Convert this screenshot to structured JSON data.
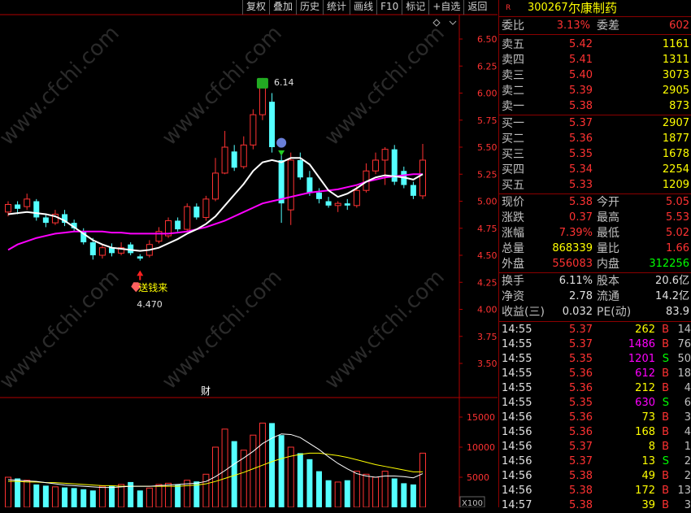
{
  "toolbar": {
    "buttons": [
      "复权",
      "叠加",
      "历史",
      "统计",
      "画线",
      "F10",
      "标记",
      "+自选",
      "返回"
    ]
  },
  "watermark": "www.cfchi.com",
  "main_chart": {
    "y_ticks": [
      "6.50",
      "6.25",
      "6.00",
      "5.75",
      "5.50",
      "5.25",
      "5.00",
      "4.75",
      "4.50",
      "4.25",
      "4.00",
      "3.75",
      "3.50"
    ],
    "high_label": "6.14",
    "low_label": "4.470",
    "buy_signal_text": "送钱来",
    "finance_marker": "财",
    "colors": {
      "up": "#ff3232",
      "down": "#54ffff",
      "ma_white": "#ffffff",
      "ma_magenta": "#ff00ff",
      "axis": "#b00000"
    }
  },
  "volume_chart": {
    "y_ticks": [
      "15000",
      "10000",
      "5000"
    ],
    "unit": "X100"
  },
  "chart_data": [
    {
      "type": "candlestick",
      "ylim": [
        3.3,
        6.6
      ],
      "candles": [
        {
          "o": 4.9,
          "c": 4.97,
          "h": 5.0,
          "l": 4.86
        },
        {
          "o": 4.97,
          "c": 4.93,
          "h": 5.0,
          "l": 4.88
        },
        {
          "o": 4.95,
          "c": 5.02,
          "h": 5.07,
          "l": 4.92
        },
        {
          "o": 5.0,
          "c": 4.85,
          "h": 5.02,
          "l": 4.82
        },
        {
          "o": 4.85,
          "c": 4.8,
          "h": 4.88,
          "l": 4.76
        },
        {
          "o": 4.8,
          "c": 4.88,
          "h": 4.92,
          "l": 4.78
        },
        {
          "o": 4.88,
          "c": 4.8,
          "h": 4.92,
          "l": 4.77
        },
        {
          "o": 4.8,
          "c": 4.75,
          "h": 4.83,
          "l": 4.72
        },
        {
          "o": 4.72,
          "c": 4.62,
          "h": 4.75,
          "l": 4.6
        },
        {
          "o": 4.62,
          "c": 4.5,
          "h": 4.66,
          "l": 4.46
        },
        {
          "o": 4.5,
          "c": 4.57,
          "h": 4.6,
          "l": 4.47
        },
        {
          "o": 4.57,
          "c": 4.52,
          "h": 4.61,
          "l": 4.49
        },
        {
          "o": 4.52,
          "c": 4.57,
          "h": 4.62,
          "l": 4.5
        },
        {
          "o": 4.6,
          "c": 4.52,
          "h": 4.62,
          "l": 4.5
        },
        {
          "o": 4.49,
          "c": 4.47,
          "h": 4.51,
          "l": 4.45
        },
        {
          "o": 4.5,
          "c": 4.6,
          "h": 4.64,
          "l": 4.48
        },
        {
          "o": 4.63,
          "c": 4.72,
          "h": 4.76,
          "l": 4.61
        },
        {
          "o": 4.68,
          "c": 4.82,
          "h": 4.85,
          "l": 4.66
        },
        {
          "o": 4.82,
          "c": 4.74,
          "h": 4.85,
          "l": 4.72
        },
        {
          "o": 4.74,
          "c": 4.95,
          "h": 4.98,
          "l": 4.72
        },
        {
          "o": 4.95,
          "c": 4.85,
          "h": 4.98,
          "l": 4.83
        },
        {
          "o": 4.85,
          "c": 5.02,
          "h": 5.05,
          "l": 4.82
        },
        {
          "o": 5.02,
          "c": 5.26,
          "h": 5.4,
          "l": 5.0
        },
        {
          "o": 5.26,
          "c": 5.5,
          "h": 5.65,
          "l": 5.25
        },
        {
          "o": 5.46,
          "c": 5.31,
          "h": 5.52,
          "l": 5.28
        },
        {
          "o": 5.32,
          "c": 5.52,
          "h": 5.6,
          "l": 5.3
        },
        {
          "o": 5.52,
          "c": 5.8,
          "h": 5.85,
          "l": 5.48
        },
        {
          "o": 5.8,
          "c": 6.08,
          "h": 6.14,
          "l": 5.75
        },
        {
          "o": 5.92,
          "c": 5.5,
          "h": 6.0,
          "l": 5.45
        },
        {
          "o": 5.38,
          "c": 4.98,
          "h": 5.45,
          "l": 4.8
        },
        {
          "o": 4.92,
          "c": 5.38,
          "h": 5.45,
          "l": 4.78
        },
        {
          "o": 5.38,
          "c": 5.22,
          "h": 5.45,
          "l": 5.2
        },
        {
          "o": 5.22,
          "c": 5.08,
          "h": 5.28,
          "l": 5.05
        },
        {
          "o": 5.08,
          "c": 5.02,
          "h": 5.12,
          "l": 4.98
        },
        {
          "o": 5.0,
          "c": 4.96,
          "h": 5.04,
          "l": 4.94
        },
        {
          "o": 4.96,
          "c": 4.98,
          "h": 5.0,
          "l": 4.9
        },
        {
          "o": 4.98,
          "c": 4.96,
          "h": 5.02,
          "l": 4.92
        },
        {
          "o": 4.96,
          "c": 5.1,
          "h": 5.14,
          "l": 4.94
        },
        {
          "o": 5.1,
          "c": 5.28,
          "h": 5.35,
          "l": 5.08
        },
        {
          "o": 5.28,
          "c": 5.38,
          "h": 5.45,
          "l": 5.25
        },
        {
          "o": 5.38,
          "c": 5.48,
          "h": 5.5,
          "l": 5.15
        },
        {
          "o": 5.48,
          "c": 5.18,
          "h": 5.52,
          "l": 5.15
        },
        {
          "o": 5.28,
          "c": 5.15,
          "h": 5.32,
          "l": 5.12
        },
        {
          "o": 5.15,
          "c": 5.05,
          "h": 5.18,
          "l": 5.02
        },
        {
          "o": 5.05,
          "c": 5.38,
          "h": 5.53,
          "l": 5.02
        }
      ],
      "ma_white": [
        4.88,
        4.89,
        4.9,
        4.89,
        4.88,
        4.86,
        4.82,
        4.76,
        4.7,
        4.64,
        4.6,
        4.57,
        4.56,
        4.55,
        4.54,
        4.55,
        4.57,
        4.61,
        4.65,
        4.7,
        4.74,
        4.79,
        4.86,
        4.96,
        5.06,
        5.16,
        5.28,
        5.36,
        5.38,
        5.36,
        5.4,
        5.4,
        5.34,
        5.22,
        5.1,
        5.04,
        5.07,
        5.12,
        5.18,
        5.22,
        5.24,
        5.23,
        5.22,
        5.2,
        5.25
      ],
      "ma_magenta": [
        4.55,
        4.6,
        4.63,
        4.66,
        4.68,
        4.7,
        4.71,
        4.72,
        4.72,
        4.72,
        4.72,
        4.71,
        4.71,
        4.7,
        4.7,
        4.7,
        4.7,
        4.7,
        4.71,
        4.72,
        4.74,
        4.76,
        4.79,
        4.82,
        4.86,
        4.9,
        4.94,
        4.98,
        5.0,
        5.02,
        5.04,
        5.06,
        5.08,
        5.09,
        5.1,
        5.11,
        5.13,
        5.15,
        5.18,
        5.2,
        5.22,
        5.23,
        5.24,
        5.25,
        5.25
      ]
    },
    {
      "type": "bar",
      "ylim": [
        0,
        17000
      ],
      "values": [
        5000,
        4800,
        4500,
        3800,
        3600,
        3400,
        3300,
        3200,
        3000,
        2800,
        3500,
        3600,
        3800,
        4200,
        2800,
        3200,
        3800,
        4000,
        3800,
        4500,
        4300,
        5500,
        10000,
        13000,
        11000,
        9500,
        12000,
        14000,
        14000,
        12000,
        10000,
        9000,
        8000,
        6000,
        4500,
        4200,
        4500,
        6000,
        5500,
        5000,
        6000,
        4800,
        4000,
        3800,
        9000
      ],
      "ma_white": [
        4600,
        4500,
        4400,
        4300,
        4100,
        3900,
        3700,
        3600,
        3500,
        3400,
        3300,
        3300,
        3400,
        3500,
        3500,
        3500,
        3600,
        3700,
        3800,
        3900,
        4000,
        4300,
        5100,
        6100,
        7200,
        8200,
        9300,
        10600,
        11500,
        12200,
        12100,
        11600,
        10600,
        9600,
        8400,
        7300,
        6400,
        5600,
        5200,
        5000,
        5200,
        5200,
        5100,
        4900,
        5600
      ],
      "ma_yellow": [
        4300,
        4300,
        4200,
        4200,
        4100,
        4100,
        4000,
        3900,
        3800,
        3700,
        3600,
        3600,
        3500,
        3500,
        3500,
        3500,
        3500,
        3500,
        3500,
        3600,
        3700,
        3900,
        4300,
        4800,
        5300,
        5800,
        6400,
        7000,
        7600,
        8100,
        8500,
        8800,
        9000,
        9000,
        8800,
        8600,
        8300,
        7900,
        7500,
        7100,
        6800,
        6500,
        6200,
        5900,
        5900
      ]
    }
  ],
  "quote": {
    "rank_mark": "R",
    "code": "300267",
    "name": "尔康制药",
    "weibi_label": "委比",
    "weibi_value": "3.13%",
    "weicha_label": "委差",
    "weicha_value": "602",
    "asks": [
      {
        "label": "卖五",
        "price": "5.42",
        "vol": "1161"
      },
      {
        "label": "卖四",
        "price": "5.41",
        "vol": "1311"
      },
      {
        "label": "卖三",
        "price": "5.40",
        "vol": "3073"
      },
      {
        "label": "卖二",
        "price": "5.39",
        "vol": "2905"
      },
      {
        "label": "卖一",
        "price": "5.38",
        "vol": "873"
      }
    ],
    "bids": [
      {
        "label": "买一",
        "price": "5.37",
        "vol": "2907"
      },
      {
        "label": "买二",
        "price": "5.36",
        "vol": "1877"
      },
      {
        "label": "买三",
        "price": "5.35",
        "vol": "1678"
      },
      {
        "label": "买四",
        "price": "5.34",
        "vol": "2254"
      },
      {
        "label": "买五",
        "price": "5.33",
        "vol": "1209"
      }
    ],
    "stats": [
      {
        "l1": "现价",
        "v1": "5.38",
        "c1": "#ff3232",
        "l2": "今开",
        "v2": "5.05",
        "c2": "#ff3232"
      },
      {
        "l1": "涨跌",
        "v1": "0.37",
        "c1": "#ff3232",
        "l2": "最高",
        "v2": "5.53",
        "c2": "#ff3232"
      },
      {
        "l1": "涨幅",
        "v1": "7.39%",
        "c1": "#ff3232",
        "l2": "最低",
        "v2": "5.02",
        "c2": "#ff3232"
      },
      {
        "l1": "总量",
        "v1": "868339",
        "c1": "#ffff00",
        "l2": "量比",
        "v2": "1.66",
        "c2": "#ff3232"
      },
      {
        "l1": "外盘",
        "v1": "556083",
        "c1": "#ff3232",
        "l2": "内盘",
        "v2": "312256",
        "c2": "#00ff00"
      }
    ],
    "stats2": [
      {
        "l1": "换手",
        "v1": "6.11%",
        "l2": "股本",
        "v2": "20.6亿"
      },
      {
        "l1": "净资",
        "v1": "2.78",
        "l2": "流通",
        "v2": "14.2亿"
      },
      {
        "l1": "收益(三)",
        "v1": "0.032",
        "l2": "PE(动)",
        "v2": "83.9"
      }
    ],
    "ticks": [
      {
        "t": "14:55",
        "p": "5.37",
        "v": "262",
        "d": "B",
        "n": "14"
      },
      {
        "t": "14:55",
        "p": "5.37",
        "v": "1486",
        "d": "B",
        "n": "76"
      },
      {
        "t": "14:55",
        "p": "5.35",
        "v": "1201",
        "d": "S",
        "n": "50"
      },
      {
        "t": "14:55",
        "p": "5.36",
        "v": "612",
        "d": "B",
        "n": "18"
      },
      {
        "t": "14:55",
        "p": "5.36",
        "v": "212",
        "d": "B",
        "n": "4"
      },
      {
        "t": "14:55",
        "p": "5.35",
        "v": "630",
        "d": "S",
        "n": "6"
      },
      {
        "t": "14:56",
        "p": "5.36",
        "v": "73",
        "d": "B",
        "n": "3"
      },
      {
        "t": "14:56",
        "p": "5.36",
        "v": "168",
        "d": "B",
        "n": "4"
      },
      {
        "t": "14:56",
        "p": "5.37",
        "v": "8",
        "d": "B",
        "n": "1"
      },
      {
        "t": "14:56",
        "p": "5.37",
        "v": "13",
        "d": "S",
        "n": "2"
      },
      {
        "t": "14:56",
        "p": "5.38",
        "v": "49",
        "d": "B",
        "n": "2"
      },
      {
        "t": "14:56",
        "p": "5.38",
        "v": "172",
        "d": "B",
        "n": "13"
      },
      {
        "t": "14:57",
        "p": "5.38",
        "v": "39",
        "d": "B",
        "n": "3"
      }
    ]
  }
}
